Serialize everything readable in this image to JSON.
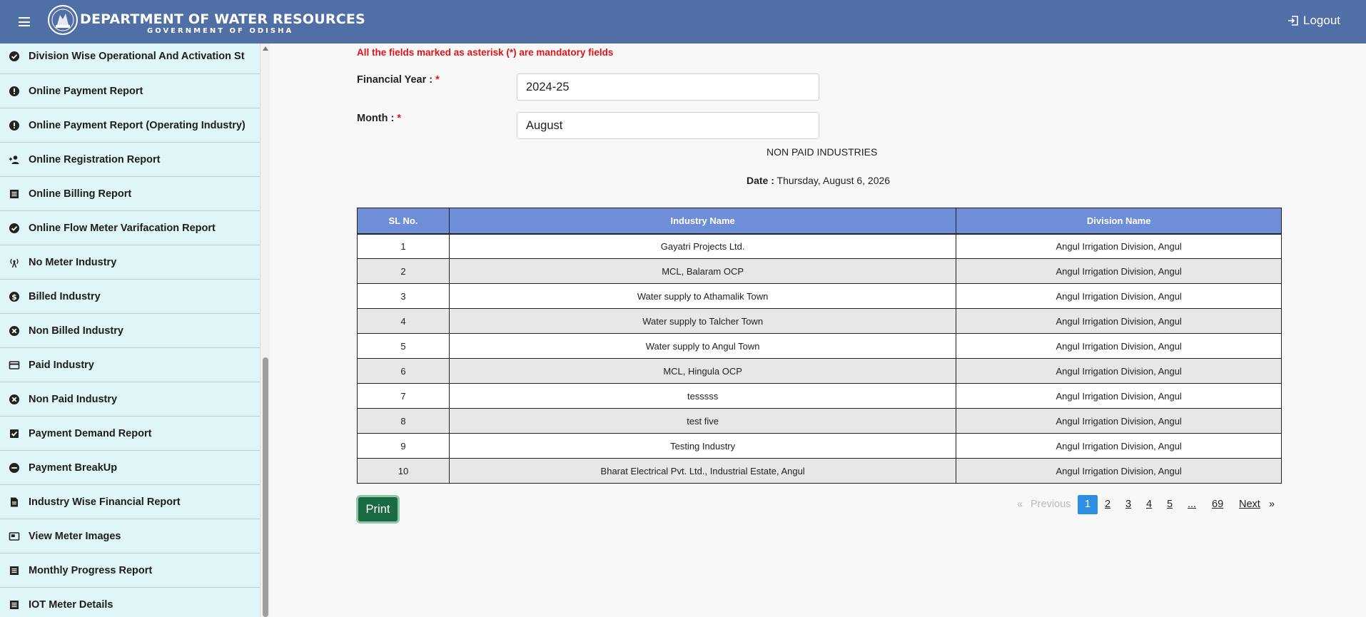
{
  "header": {
    "title": "DEPARTMENT OF WATER RESOURCES",
    "subtitle": "GOVERNMENT OF ODISHA",
    "logout_label": "Logout"
  },
  "sidebar": {
    "items": [
      {
        "label": "Division Wise Operational And Activation St",
        "icon": "check-circle-icon"
      },
      {
        "label": "Online Payment Report",
        "icon": "alert-circle-icon"
      },
      {
        "label": "Online Payment Report (Operating Industry)",
        "icon": "alert-circle-icon"
      },
      {
        "label": "Online Registration Report",
        "icon": "person-add-icon"
      },
      {
        "label": "Online Billing Report",
        "icon": "list-icon"
      },
      {
        "label": "Online Flow Meter Varifacation Report",
        "icon": "check-circle-icon"
      },
      {
        "label": "No Meter Industry",
        "icon": "antenna-icon"
      },
      {
        "label": "Billed Industry",
        "icon": "dollar-circle-icon"
      },
      {
        "label": "Non Billed Industry",
        "icon": "x-circle-icon"
      },
      {
        "label": "Paid Industry",
        "icon": "credit-card-icon"
      },
      {
        "label": "Non Paid Industry",
        "icon": "x-circle-icon"
      },
      {
        "label": "Payment Demand Report",
        "icon": "checkbox-icon"
      },
      {
        "label": "Payment BreakUp",
        "icon": "minus-circle-icon"
      },
      {
        "label": "Industry Wise Financial Report",
        "icon": "document-icon"
      },
      {
        "label": "View Meter Images",
        "icon": "picture-in-picture-icon"
      },
      {
        "label": "Monthly Progress Report",
        "icon": "list-icon"
      },
      {
        "label": "IOT Meter Details",
        "icon": "list-icon"
      }
    ]
  },
  "form": {
    "mandatory_note": "All the fields marked as asterisk (*) are mandatory fields",
    "financial_year_label": "Financial Year :",
    "financial_year_value": "2024-25",
    "month_label": "Month :",
    "month_value": "August",
    "required_mark": "*"
  },
  "report": {
    "title": "NON PAID INDUSTRIES",
    "date_label": "Date :",
    "date_value": "Thursday, August 6, 2026"
  },
  "table": {
    "headers": [
      "SL No.",
      "Industry Name",
      "Division Name"
    ],
    "rows": [
      [
        "1",
        "Gayatri Projects Ltd.",
        "Angul Irrigation Division, Angul"
      ],
      [
        "2",
        "MCL, Balaram OCP",
        "Angul Irrigation Division, Angul"
      ],
      [
        "3",
        "Water supply to Athamalik Town",
        "Angul Irrigation Division, Angul"
      ],
      [
        "4",
        "Water supply to Talcher Town",
        "Angul Irrigation Division, Angul"
      ],
      [
        "5",
        "Water supply to Angul Town",
        "Angul Irrigation Division, Angul"
      ],
      [
        "6",
        "MCL, Hingula OCP",
        "Angul Irrigation Division, Angul"
      ],
      [
        "7",
        "tesssss",
        "Angul Irrigation Division, Angul"
      ],
      [
        "8",
        "test five",
        "Angul Irrigation Division, Angul"
      ],
      [
        "9",
        "Testing Industry",
        "Angul Irrigation Division, Angul"
      ],
      [
        "10",
        "Bharat Electrical Pvt. Ltd., Industrial Estate, Angul",
        "Angul Irrigation Division, Angul"
      ]
    ]
  },
  "actions": {
    "print_label": "Print"
  },
  "pagination": {
    "prev_arrow": "«",
    "prev_label": "Previous",
    "pages": [
      "1",
      "2",
      "3",
      "4",
      "5"
    ],
    "ellipsis": "...",
    "last_page": "69",
    "next_label": "Next",
    "next_arrow": "»",
    "current": "1"
  },
  "colors": {
    "header_bg": "#4f6fa6",
    "sidebar_bg": "#e0f5f7",
    "table_header_bg": "#6f8ed8",
    "print_button_bg": "#1a6b43",
    "active_page_bg": "#2e8fe0",
    "required_red": "#e01313"
  }
}
